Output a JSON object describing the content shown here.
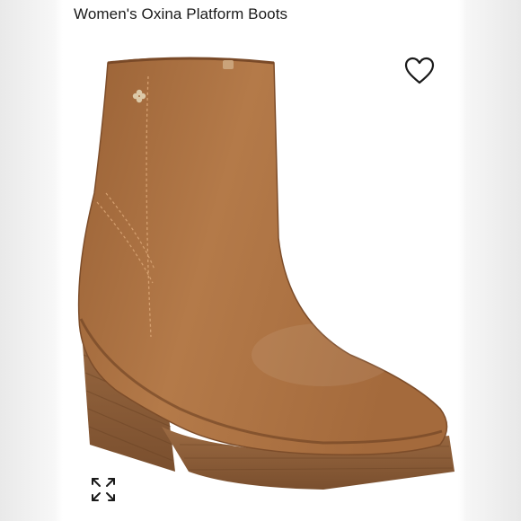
{
  "product": {
    "title": "Women's Oxina Platform Boots"
  },
  "icons": {
    "favorite": "heart-outline-icon",
    "expand": "expand-arrows-icon"
  },
  "colors": {
    "leather": "#a86f41",
    "leather_light": "#c08a58",
    "heel_wood": "#8a5a34",
    "text": "#1a1a1a"
  }
}
